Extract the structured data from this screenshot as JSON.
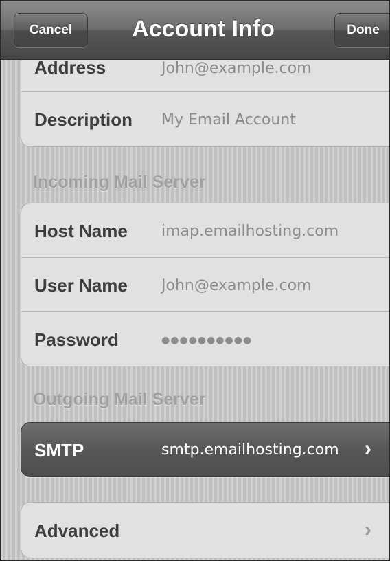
{
  "navbar": {
    "title": "Account Info",
    "cancel_label": "Cancel",
    "done_label": "Done"
  },
  "account": {
    "rows": [
      {
        "label": "Address",
        "value": "John@example.com"
      },
      {
        "label": "Description",
        "value": "My Email Account"
      }
    ]
  },
  "incoming": {
    "header": "Incoming Mail Server",
    "rows": [
      {
        "label": "Host Name",
        "value": "imap.emailhosting.com"
      },
      {
        "label": "User Name",
        "value": "John@example.com"
      },
      {
        "label": "Password",
        "value": "●●●●●●●●●●"
      }
    ]
  },
  "outgoing": {
    "header": "Outgoing Mail Server",
    "smtp_label": "SMTP",
    "smtp_value": "smtp.emailhosting.com"
  },
  "advanced": {
    "label": "Advanced"
  },
  "icons": {
    "chevron": "›"
  },
  "colors": {
    "navbar": "#5a5a5a",
    "cell_bg": "#e1e1e1",
    "selected_row": "#555555"
  }
}
